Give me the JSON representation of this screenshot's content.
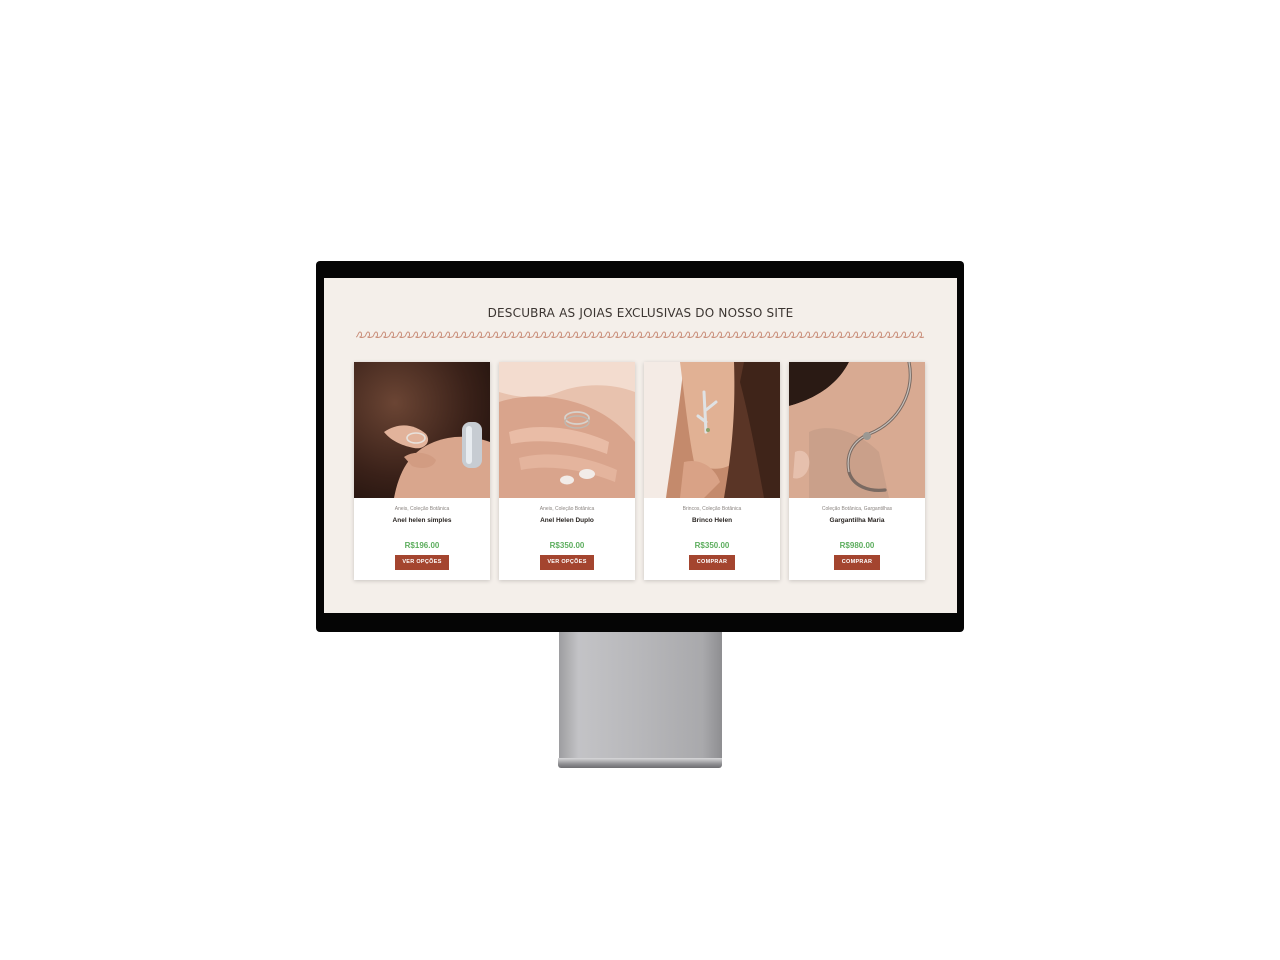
{
  "colors": {
    "screen_background": "#f4efea",
    "accent": "#a4452f",
    "price": "#5dae5e",
    "divider": "#c98e7a"
  },
  "section": {
    "title": "DESCUBRA AS JOIAS EXCLUSIVAS DO NOSSO SITE"
  },
  "products": [
    {
      "categories": "Aneis, Coleção Botânica",
      "name": "Anel helen simples",
      "price": "R$196.00",
      "button": "VER OPÇÕES",
      "image": "ring-on-hand-photo"
    },
    {
      "categories": "Aneis, Coleção Botânica",
      "name": "Anel Helen Duplo",
      "price": "R$350.00",
      "button": "VER OPÇÕES",
      "image": "double-ring-on-hand-photo"
    },
    {
      "categories": "Brincos, Coleção Botânica",
      "name": "Brinco Helen",
      "price": "R$350.00",
      "button": "COMPRAR",
      "image": "branch-earring-photo"
    },
    {
      "categories": "Coleção Botânica, Gargantilhas",
      "name": "Gargantilha Maria",
      "price": "R$980.00",
      "button": "COMPRAR",
      "image": "choker-necklace-photo"
    }
  ]
}
